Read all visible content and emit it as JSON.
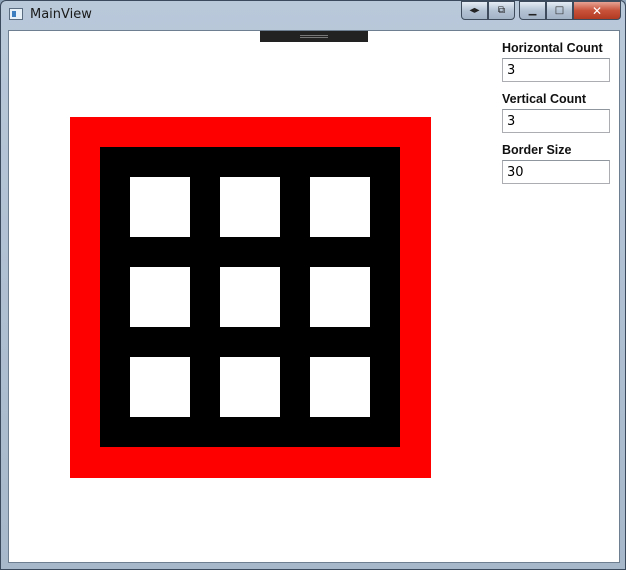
{
  "window": {
    "title": "MainView"
  },
  "caption_buttons": {
    "extra1_icon": "arrows-left-right-icon",
    "extra2_icon": "pin-icon",
    "minimize_icon": "minimize-icon",
    "maximize_icon": "maximize-icon",
    "close_icon": "close-icon"
  },
  "settings": {
    "horizontal_count": {
      "label": "Horizontal Count",
      "value": "3"
    },
    "vertical_count": {
      "label": "Vertical Count",
      "value": "3"
    },
    "border_size": {
      "label": "Border Size",
      "value": "30"
    }
  },
  "grid": {
    "columns": 3,
    "rows": 3,
    "outer_color": "#ff0000",
    "inner_color": "#000000",
    "cell_color": "#ffffff"
  }
}
